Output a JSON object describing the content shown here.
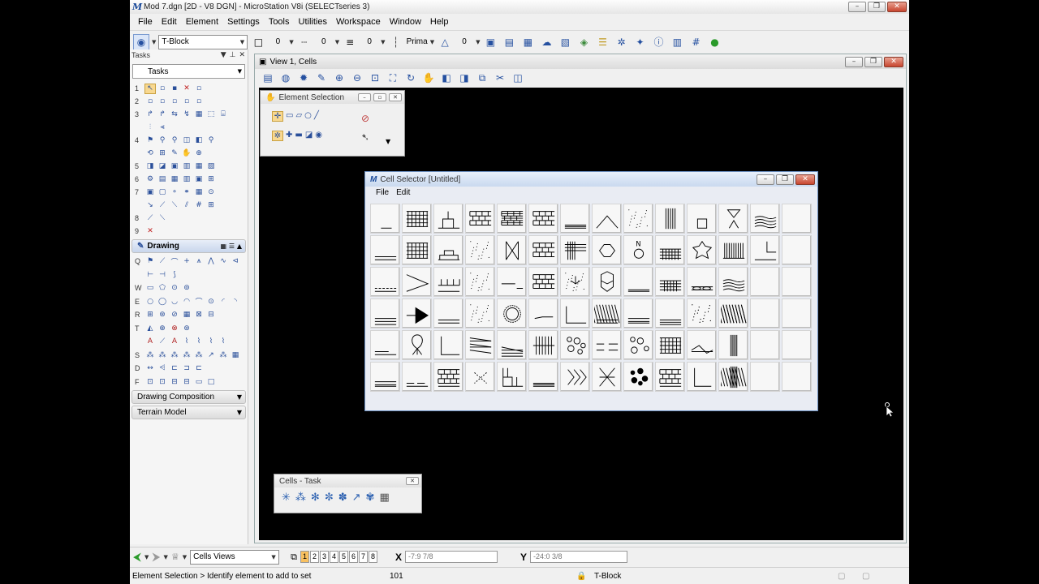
{
  "window": {
    "title": "Mod 7.dgn [2D - V8 DGN] - MicroStation V8i (SELECTseries 3)",
    "logo": "M"
  },
  "menu": [
    "File",
    "Edit",
    "Element",
    "Settings",
    "Tools",
    "Utilities",
    "Workspace",
    "Window",
    "Help"
  ],
  "attributes": {
    "level": "T-Block",
    "color": "0",
    "style": "0",
    "weight": "0",
    "class": "Prima",
    "transparency": "0"
  },
  "tasks": {
    "title": "Tasks",
    "combo": "Tasks",
    "rows": [
      "1",
      "2",
      "3",
      "",
      "4",
      "",
      "5",
      "6",
      "7",
      "",
      "8",
      "9"
    ],
    "drawing": {
      "label": "Drawing",
      "rows": [
        "Q",
        "",
        "W",
        "E",
        "R",
        "T",
        "",
        "S",
        "D",
        "F"
      ]
    },
    "sections": [
      "Drawing Composition",
      "Terrain Model"
    ]
  },
  "view": {
    "title": "View 1, Cells"
  },
  "element_selection": {
    "title": "Element Selection"
  },
  "cell_selector": {
    "title": "Cell Selector [Untitled]",
    "menu": [
      "File",
      "Edit"
    ]
  },
  "cells_task": {
    "title": "Cells - Task"
  },
  "bottom": {
    "views_combo": "Cells Views",
    "views": [
      "1",
      "2",
      "3",
      "4",
      "5",
      "6",
      "7",
      "8"
    ],
    "x_label": "X",
    "x_value": "-7:9 7/8",
    "y_label": "Y",
    "y_value": "-24:0 3/8"
  },
  "status": {
    "prompt": "Element Selection > Identify element to add to set",
    "count": "101",
    "level": "T-Block"
  }
}
